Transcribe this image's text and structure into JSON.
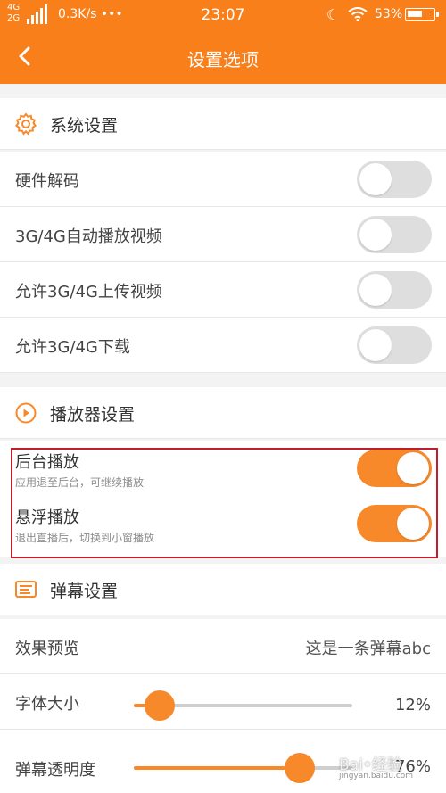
{
  "status_bar": {
    "network_top": "4G",
    "network_bottom": "2G",
    "speed": "0.3K/s •••",
    "time": "23:07",
    "battery": "53%",
    "icons": [
      "signal-icon",
      "moon-icon",
      "wifi-icon",
      "battery-icon"
    ]
  },
  "app_bar": {
    "title": "设置选项",
    "back_icon": "back-chevron-icon"
  },
  "system": {
    "title": "系统设置",
    "icon": "gear-icon",
    "items": [
      {
        "label": "硬件解码",
        "on": false
      },
      {
        "label": "3G/4G自动播放视频",
        "on": false
      },
      {
        "label": "允许3G/4G上传视频",
        "on": false
      },
      {
        "label": "允许3G/4G下载",
        "on": false
      }
    ]
  },
  "player": {
    "title": "播放器设置",
    "icon": "play-circle-icon",
    "items": [
      {
        "label": "后台播放",
        "sub": "应用退至后台，可继续播放",
        "on": true
      },
      {
        "label": "悬浮播放",
        "sub": "退出直播后，切换到小窗播放",
        "on": true
      }
    ]
  },
  "danmaku": {
    "title": "弹幕设置",
    "icon": "danmaku-icon",
    "preview_label": "效果预览",
    "preview_text": "这是一条弹幕abc",
    "font_size_label": "字体大小",
    "font_size_value": "12%",
    "font_size_fraction": 0.12,
    "opacity_label": "弹幕透明度",
    "opacity_value": "76%",
    "opacity_fraction": 0.76
  },
  "colors": {
    "accent": "#f97f1a",
    "toggle_off": "#dedede",
    "highlight_border": "#c41c2a"
  },
  "watermark": {
    "text": "Bai•经验",
    "url": "jingyan.baidu.com"
  }
}
